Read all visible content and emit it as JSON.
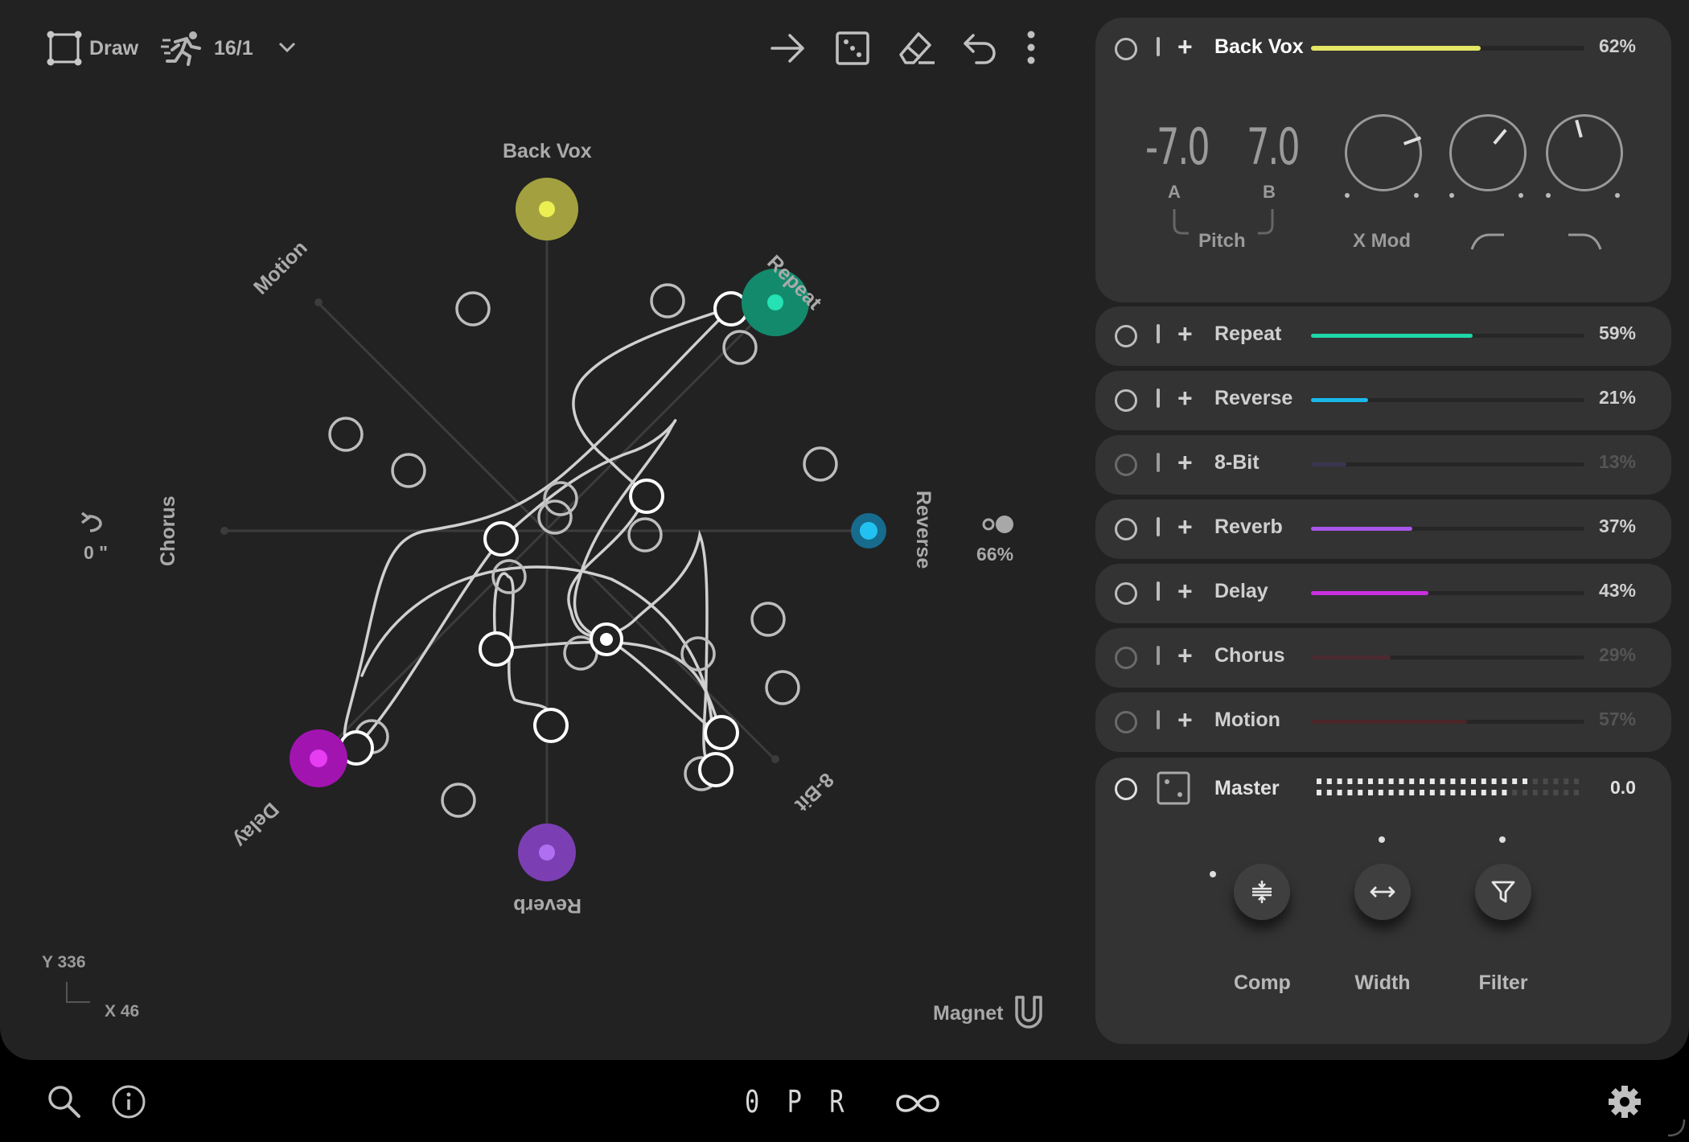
{
  "toolbar": {
    "draw_label": "Draw",
    "speed_label": "16/1",
    "icons": [
      "draw-rect-icon",
      "running-figure-icon",
      "chevron-down-icon",
      "arrow-right-icon",
      "dice-icon",
      "eraser-icon",
      "undo-icon",
      "more-vertical-icon"
    ]
  },
  "pad": {
    "labels": {
      "back_vox": "Back Vox",
      "repeat": "Repeat",
      "reverse": "Reverse",
      "eight_bit": "8-Bit",
      "reverb": "Reverb",
      "delay": "Delay",
      "chorus": "Chorus",
      "motion": "Motion"
    },
    "rotation_value": "0 \"",
    "mix_value": "66%",
    "coord_y": "Y 336",
    "coord_x": "X 46",
    "magnet_label": "Magnet"
  },
  "top_panel": {
    "name": "Back Vox",
    "percent": "62%",
    "level": 0.62,
    "color": "#e4e665",
    "pitch_a_value": "-7.0",
    "pitch_b_value": "7.0",
    "pitch_a_label": "A",
    "pitch_b_label": "B",
    "pitch_label": "Pitch",
    "xmod_label": "X Mod"
  },
  "rows": [
    {
      "name": "Repeat",
      "percent": "59%",
      "level": 0.59,
      "color": "#1fd6a8",
      "dim": false
    },
    {
      "name": "Reverse",
      "percent": "21%",
      "level": 0.21,
      "color": "#1ab8ea",
      "dim": false
    },
    {
      "name": "8-Bit",
      "percent": "13%",
      "level": 0.13,
      "color": "#3a3650",
      "dim": true
    },
    {
      "name": "Reverb",
      "percent": "37%",
      "level": 0.37,
      "color": "#a855e8",
      "dim": false
    },
    {
      "name": "Delay",
      "percent": "43%",
      "level": 0.43,
      "color": "#cc2fe0",
      "dim": false
    },
    {
      "name": "Chorus",
      "percent": "29%",
      "level": 0.29,
      "color": "#4c2a30",
      "dim": true
    },
    {
      "name": "Motion",
      "percent": "57%",
      "level": 0.57,
      "color": "#4a2628",
      "dim": true
    }
  ],
  "master": {
    "name": "Master",
    "value": "0.0",
    "comp_label": "Comp",
    "width_label": "Width",
    "filter_label": "Filter"
  },
  "footer": {
    "logo_text": "0 P R"
  }
}
